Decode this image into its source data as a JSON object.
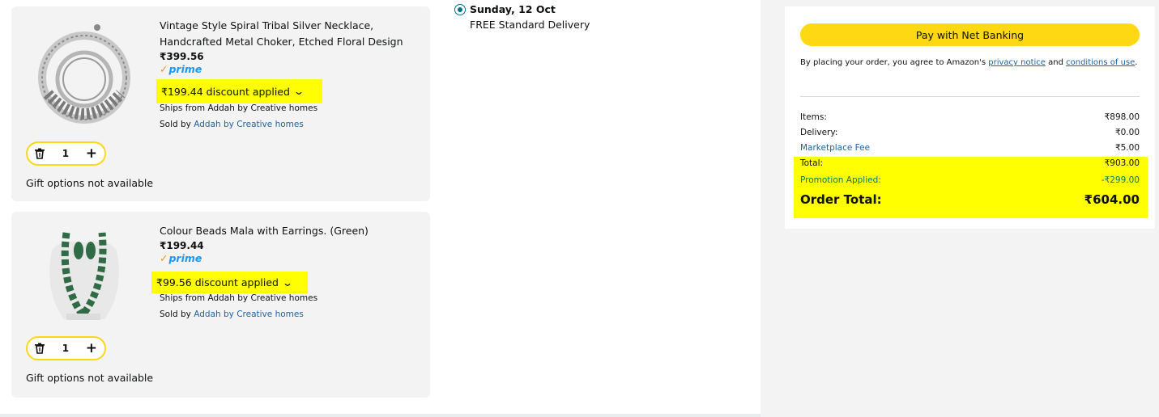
{
  "cart": {
    "items": [
      {
        "title": "Vintage Style Spiral Tribal Silver Necklace, Handcrafted Metal Choker, Etched Floral Design",
        "price": "₹399.56",
        "prime": "prime",
        "discount": "₹199.44 discount applied",
        "ships_from": "Ships from Addah by Creative homes",
        "sold_by_label": "Sold by",
        "sold_by_seller": "Addah by Creative homes",
        "quantity": "1",
        "gift": "Gift options not available"
      },
      {
        "title": "Colour Beads Mala with Earrings. (Green)",
        "price": "₹199.44",
        "prime": "prime",
        "discount": "₹99.56 discount applied",
        "ships_from": "Ships from Addah by Creative homes",
        "sold_by_label": "Sold by",
        "sold_by_seller": "Addah by Creative homes",
        "quantity": "1",
        "gift": "Gift options not available"
      }
    ]
  },
  "delivery": {
    "date": "Sunday, 12 Oct",
    "type": "FREE Standard Delivery"
  },
  "summary": {
    "pay_button": "Pay with Net Banking",
    "agree_prefix": "By placing your order, you agree to Amazon's",
    "privacy_link": "privacy notice",
    "and": "and",
    "conditions_link": "conditions of use",
    "period": ".",
    "items_label": "Items:",
    "items_value": "₹898.00",
    "delivery_label": "Delivery:",
    "delivery_value": "₹0.00",
    "fee_label": "Marketplace Fee",
    "fee_value": "₹5.00",
    "total_label": "Total:",
    "total_value": "₹903.00",
    "promo_label": "Promotion Applied:",
    "promo_value": "-₹299.00",
    "order_total_label": "Order Total:",
    "order_total_value": "₹604.00"
  },
  "colors": {
    "highlight": "#ffff00",
    "button": "#ffd814",
    "link": "#2162a1",
    "promo": "#067d62",
    "prime": "#1a98ff"
  },
  "icons": [
    "trash-icon",
    "plus-icon",
    "chevron-down-icon",
    "radio-selected-icon",
    "prime-check-icon"
  ]
}
